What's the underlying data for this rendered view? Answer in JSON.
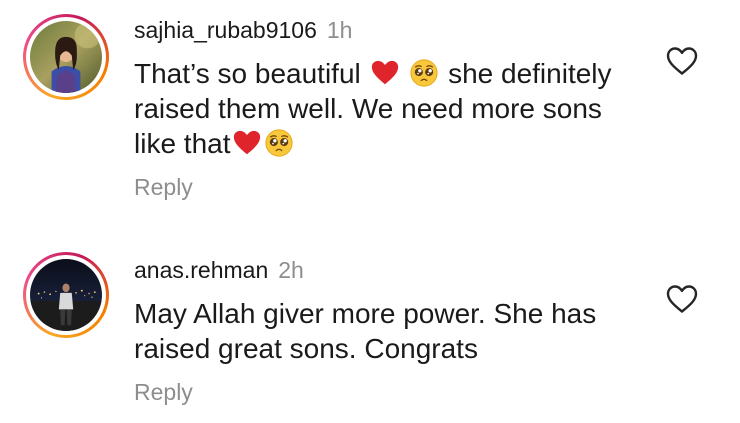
{
  "comments": [
    {
      "username": "sajhia_rubab9106",
      "time": "1h",
      "lines": [
        [
          "That’s so beautiful ",
          "heart-emoji",
          " ",
          "pleading-face-emoji",
          " she definitely"
        ],
        [
          "raised them well. We need more sons"
        ],
        [
          "like that",
          "heart-emoji",
          "pleading-face-emoji"
        ]
      ],
      "reply_label": "Reply"
    },
    {
      "username": "anas.rehman",
      "time": "2h",
      "lines": [
        [
          "May Allah giver more power. She has"
        ],
        [
          "raised great sons. Congrats"
        ]
      ],
      "reply_label": "Reply"
    }
  ],
  "icons": {
    "like": "heart-outline-icon"
  },
  "colors": {
    "text": "#1a1a1a",
    "muted": "#8e8e8e",
    "heart_emoji": "#e0242b"
  }
}
